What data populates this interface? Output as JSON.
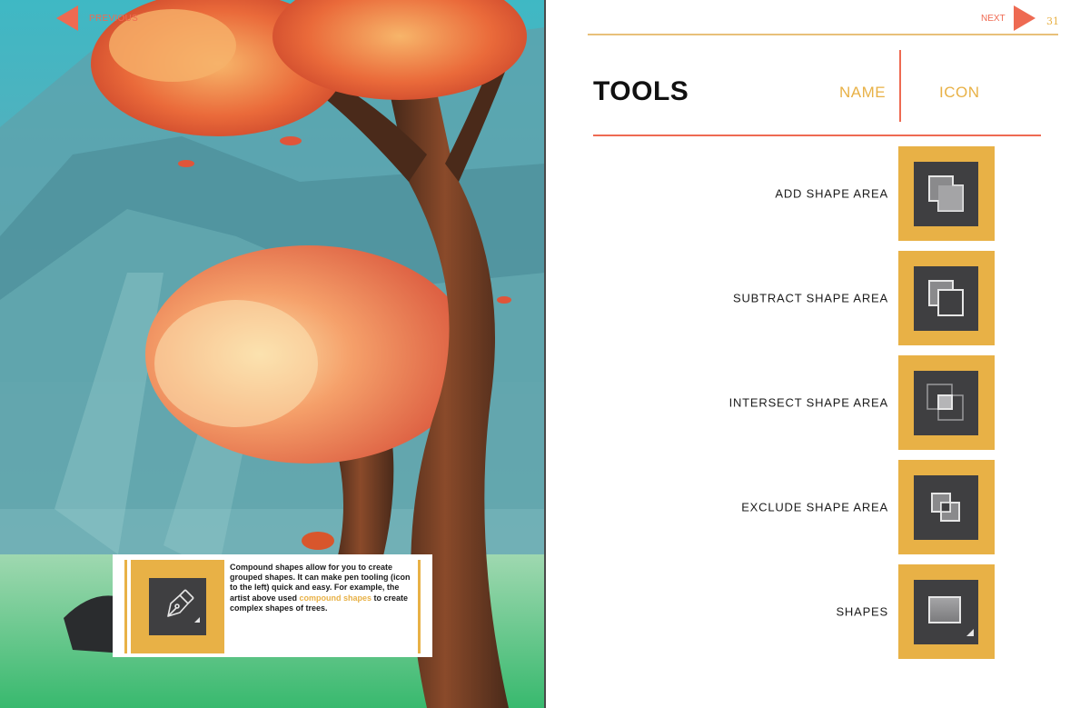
{
  "left_page": {
    "nav_previous_label": "PREVIOUS",
    "callout": {
      "text_before": "Compound shapes allow for you to create grouped shapes. It can make pen tooling (icon to the left) quick and easy. For example, the artist above used ",
      "text_highlight": "compound shapes",
      "text_after": " to create complex shapes of trees.",
      "icon": "pen-tool-icon"
    }
  },
  "right_page": {
    "nav_next_label": "NEXT",
    "page_number": "31",
    "title": "TOOLS",
    "column_name": "NAME",
    "column_icon": "ICON",
    "tools": [
      {
        "name": "ADD SHAPE AREA",
        "icon": "add-shape-area-icon"
      },
      {
        "name": "SUBTRACT SHAPE AREA",
        "icon": "subtract-shape-area-icon"
      },
      {
        "name": "INTERSECT SHAPE AREA",
        "icon": "intersect-shape-area-icon"
      },
      {
        "name": "EXCLUDE SHAPE AREA",
        "icon": "exclude-shape-area-icon"
      },
      {
        "name": "SHAPES",
        "icon": "shapes-icon"
      }
    ]
  },
  "colors": {
    "accent_orange": "#e8b146",
    "accent_red": "#ee6a52",
    "icon_dark": "#3f3f41"
  }
}
